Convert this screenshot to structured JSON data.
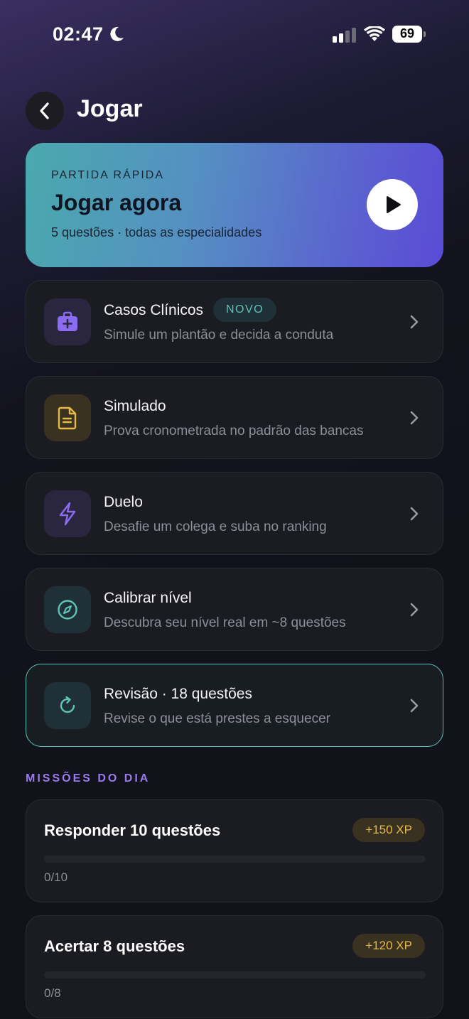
{
  "status_bar": {
    "time": "02:47",
    "battery": "69"
  },
  "header": {
    "title": "Jogar"
  },
  "hero": {
    "kicker": "PARTIDA RÁPIDA",
    "title": "Jogar agora",
    "subtitle": "5 questões · todas as especialidades"
  },
  "modes": [
    {
      "title": "Casos Clínicos",
      "badge": "NOVO",
      "subtitle": "Simule um plantão e decida a conduta",
      "icon": "medical-kit-icon",
      "color": "#8b6cf0"
    },
    {
      "title": "Simulado",
      "subtitle": "Prova cronometrada no padrão das bancas",
      "icon": "document-icon",
      "color": "#e7b84a"
    },
    {
      "title": "Duelo",
      "subtitle": "Desafie um colega e suba no ranking",
      "icon": "lightning-icon",
      "color": "#8b6cf0"
    },
    {
      "title": "Calibrar nível",
      "subtitle": "Descubra seu nível real em ~8 questões",
      "icon": "compass-icon",
      "color": "#5fc3b8"
    },
    {
      "title": "Revisão · 18 questões",
      "subtitle": "Revise o que está prestes a esquecer",
      "icon": "refresh-icon",
      "color": "#5fc3b8"
    }
  ],
  "missions_section": {
    "title": "MISSÕES DO DIA"
  },
  "missions": [
    {
      "title": "Responder 10 questões",
      "xp": "+150 XP",
      "progress_text": "0/10",
      "progress": 0
    },
    {
      "title": "Acertar 8 questões",
      "xp": "+120 XP",
      "progress_text": "0/8",
      "progress": 0
    }
  ]
}
